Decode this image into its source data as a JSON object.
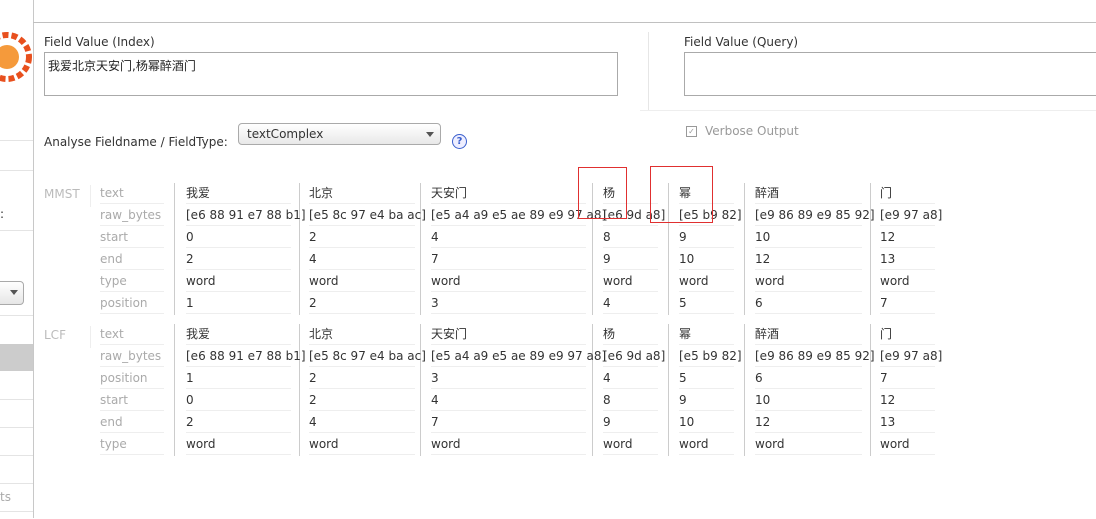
{
  "sidebar": {
    "partial_text": ":",
    "partial_label": "ts"
  },
  "form": {
    "index_label": "Field Value (Index)",
    "index_value": "我爱北京天安门,杨幂醉酒门",
    "query_label": "Field Value (Query)",
    "query_value": "",
    "fieldtype_label": "Analyse Fieldname / FieldType:",
    "fieldtype_value": "textComplex",
    "help_icon": "?",
    "verbose_label": "Verbose Output",
    "verbose_checked": true
  },
  "analysis": [
    {
      "name": "MMST",
      "attributes": [
        "text",
        "raw_bytes",
        "start",
        "end",
        "type",
        "position"
      ],
      "tokens": [
        [
          "我爱",
          "[e6 88 91 e7 88 b1]",
          "0",
          "2",
          "word",
          "1"
        ],
        [
          "北京",
          "[e5 8c 97 e4 ba ac]",
          "2",
          "4",
          "word",
          "2"
        ],
        [
          "天安门",
          "[e5 a4 a9 e5 ae 89 e9 97 a8]",
          "4",
          "7",
          "word",
          "3"
        ],
        [
          "杨",
          "[e6 9d a8]",
          "8",
          "9",
          "word",
          "4"
        ],
        [
          "幂",
          "[e5 b9 82]",
          "9",
          "10",
          "word",
          "5"
        ],
        [
          "醉酒",
          "[e9 86 89 e9 85 92]",
          "10",
          "12",
          "word",
          "6"
        ],
        [
          "门",
          "[e9 97 a8]",
          "12",
          "13",
          "word",
          "7"
        ]
      ]
    },
    {
      "name": "LCF",
      "attributes": [
        "text",
        "raw_bytes",
        "position",
        "start",
        "end",
        "type"
      ],
      "tokens": [
        [
          "我爱",
          "[e6 88 91 e7 88 b1]",
          "1",
          "0",
          "2",
          "word"
        ],
        [
          "北京",
          "[e5 8c 97 e4 ba ac]",
          "2",
          "2",
          "4",
          "word"
        ],
        [
          "天安门",
          "[e5 a4 a9 e5 ae 89 e9 97 a8]",
          "3",
          "4",
          "7",
          "word"
        ],
        [
          "杨",
          "[e6 9d a8]",
          "4",
          "8",
          "9",
          "word"
        ],
        [
          "幂",
          "[e5 b9 82]",
          "5",
          "9",
          "10",
          "word"
        ],
        [
          "醉酒",
          "[e9 86 89 e9 85 92]",
          "6",
          "10",
          "12",
          "word"
        ],
        [
          "门",
          "[e9 97 a8]",
          "7",
          "12",
          "13",
          "word"
        ]
      ]
    }
  ],
  "colors": {
    "highlight_box": "#e03030",
    "logo": "#e8501e"
  }
}
